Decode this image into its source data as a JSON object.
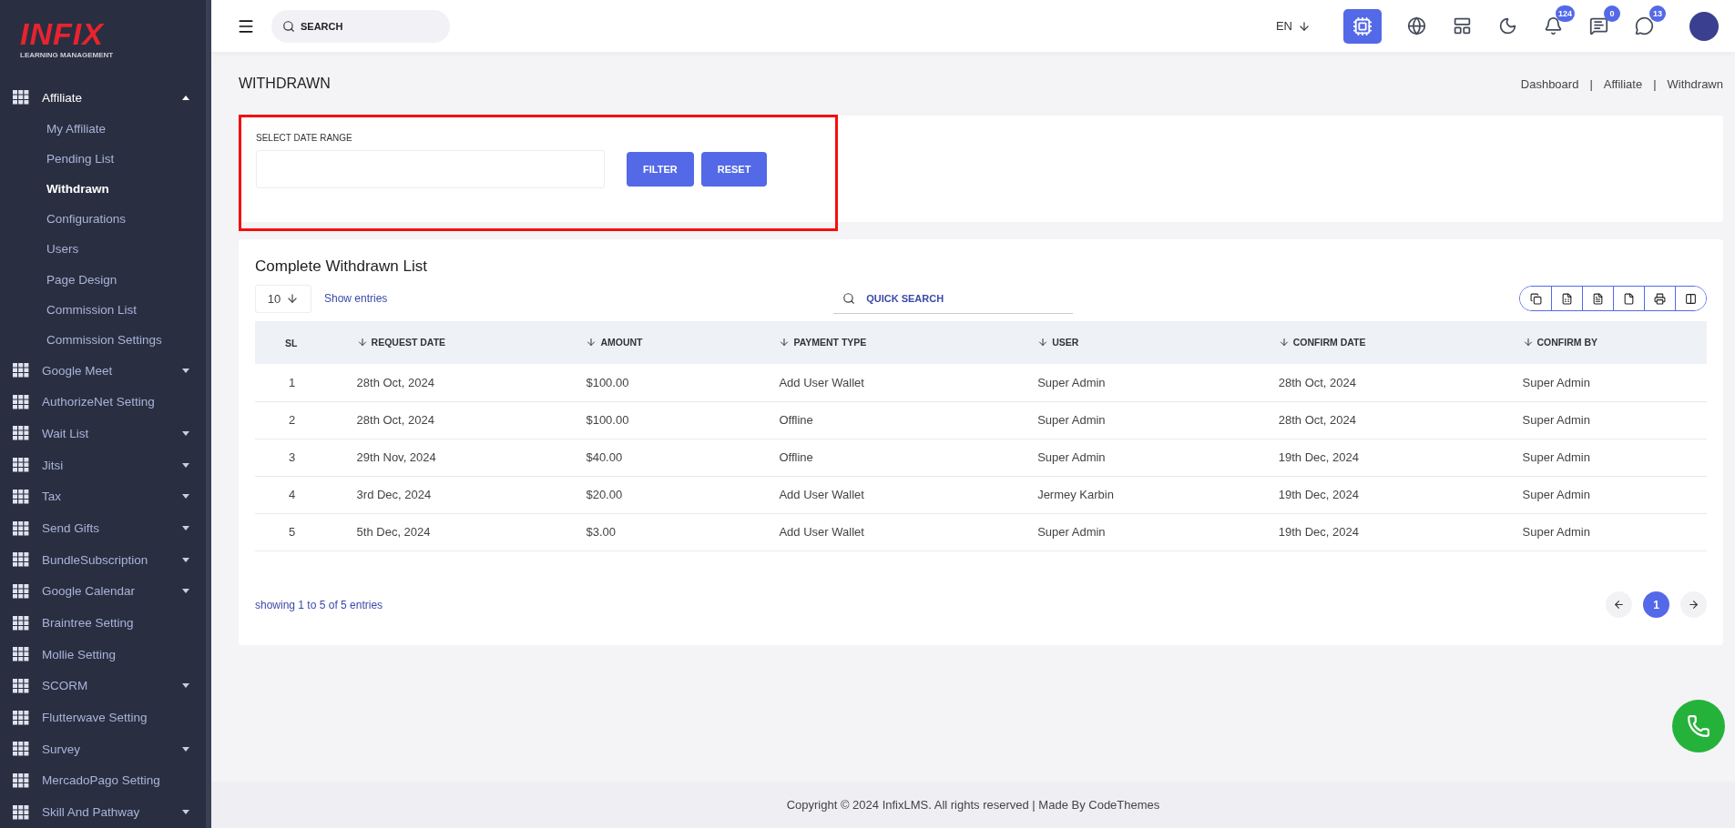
{
  "sidebar": {
    "logo": {
      "title": "INFIX",
      "subtitle": "LEARNING MANAGEMENT"
    },
    "items": [
      {
        "label": "Affiliate",
        "kind": "dropdown",
        "expanded": true,
        "children": [
          {
            "label": "My Affiliate",
            "selected": false
          },
          {
            "label": "Pending List",
            "selected": false
          },
          {
            "label": "Withdrawn",
            "selected": true
          },
          {
            "label": "Configurations",
            "selected": false
          },
          {
            "label": "Users",
            "selected": false
          },
          {
            "label": "Page Design",
            "selected": false
          },
          {
            "label": "Commission List",
            "selected": false
          },
          {
            "label": "Commission Settings",
            "selected": false
          }
        ]
      },
      {
        "label": "Google Meet",
        "kind": "dropdown",
        "expanded": false
      },
      {
        "label": "AuthorizeNet Setting",
        "kind": "link"
      },
      {
        "label": "Wait List",
        "kind": "dropdown",
        "expanded": false
      },
      {
        "label": "Jitsi",
        "kind": "dropdown",
        "expanded": false
      },
      {
        "label": "Tax",
        "kind": "dropdown",
        "expanded": false
      },
      {
        "label": "Send Gifts",
        "kind": "dropdown",
        "expanded": false
      },
      {
        "label": "BundleSubscription",
        "kind": "dropdown",
        "expanded": false
      },
      {
        "label": "Google Calendar",
        "kind": "dropdown",
        "expanded": false
      },
      {
        "label": "Braintree Setting",
        "kind": "link"
      },
      {
        "label": "Mollie Setting",
        "kind": "link"
      },
      {
        "label": "SCORM",
        "kind": "dropdown",
        "expanded": false
      },
      {
        "label": "Flutterwave Setting",
        "kind": "link"
      },
      {
        "label": "Survey",
        "kind": "dropdown",
        "expanded": false
      },
      {
        "label": "MercadoPago Setting",
        "kind": "link"
      },
      {
        "label": "Skill And Pathway",
        "kind": "dropdown",
        "expanded": false
      }
    ]
  },
  "topbar": {
    "search": {
      "placeholder": "SEARCH"
    },
    "language": "EN",
    "notifications": "124",
    "messages": "0",
    "chats": "13"
  },
  "page": {
    "title": "WITHDRAWN",
    "breadcrumb": [
      "Dashboard",
      "Affiliate",
      "Withdrawn"
    ],
    "breadcrumb_separator": "|"
  },
  "filter": {
    "label": "SELECT DATE RANGE",
    "buttons": [
      "FILTER",
      "RESET"
    ]
  },
  "list": {
    "title": "Complete Withdrawn List",
    "page_size": "10",
    "show_entries": "Show entries",
    "search": {
      "placeholder": "QUICK SEARCH"
    },
    "columns": [
      {
        "label": "SL",
        "sortable": false
      },
      {
        "label": "REQUEST DATE",
        "sortable": true
      },
      {
        "label": "AMOUNT",
        "sortable": true
      },
      {
        "label": "PAYMENT TYPE",
        "sortable": true
      },
      {
        "label": "USER",
        "sortable": true
      },
      {
        "label": "CONFIRM DATE",
        "sortable": true
      },
      {
        "label": "CONFIRM BY",
        "sortable": true
      }
    ],
    "rows": [
      [
        "1",
        "28th Oct, 2024",
        "$100.00",
        "Add User Wallet",
        "Super Admin",
        "28th Oct, 2024",
        "Super Admin"
      ],
      [
        "2",
        "28th Oct, 2024",
        "$100.00",
        "Offline",
        "Super Admin",
        "28th Oct, 2024",
        "Super Admin"
      ],
      [
        "3",
        "29th Nov, 2024",
        "$40.00",
        "Offline",
        "Super Admin",
        "19th Dec, 2024",
        "Super Admin"
      ],
      [
        "4",
        "3rd Dec, 2024",
        "$20.00",
        "Add User Wallet",
        "Jermey Karbin",
        "19th Dec, 2024",
        "Super Admin"
      ],
      [
        "5",
        "5th Dec, 2024",
        "$3.00",
        "Add User Wallet",
        "Super Admin",
        "19th Dec, 2024",
        "Super Admin"
      ]
    ],
    "info": "showing 1 to 5 of 5 entries",
    "pages": [
      {
        "label": "1",
        "selected": true
      }
    ]
  },
  "footer": "Copyright © 2024 InfixLMS. All rights reserved | Made By CodeThemes"
}
